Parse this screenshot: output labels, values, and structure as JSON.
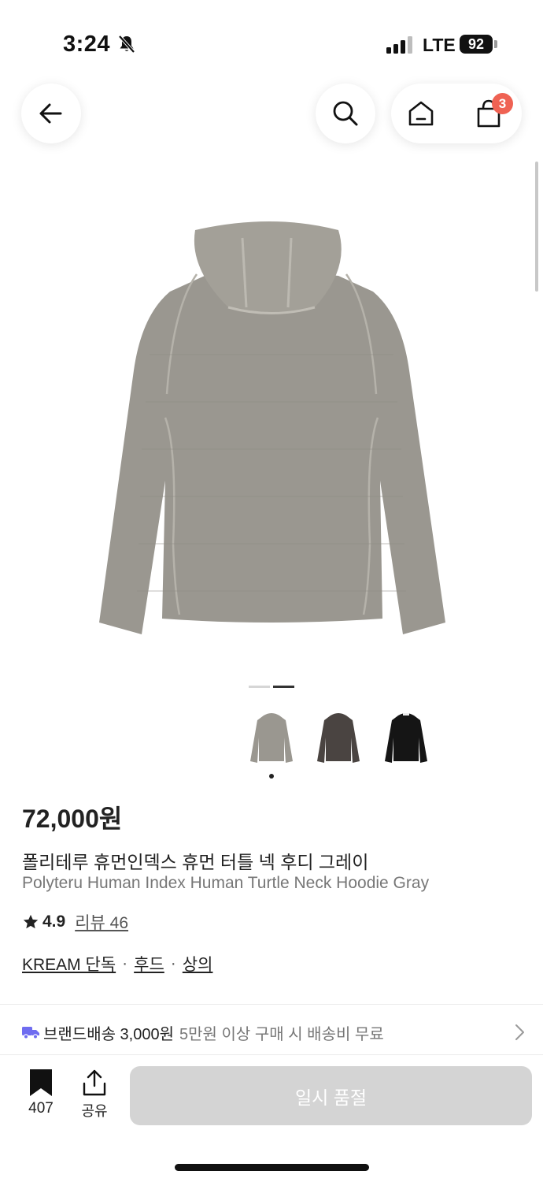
{
  "status_bar": {
    "time": "3:24",
    "network": "LTE",
    "battery": "92",
    "icons": [
      "bell-slash-icon",
      "signal-icon",
      "battery-icon"
    ]
  },
  "header": {
    "back_icon": "arrow-left-icon",
    "search_icon": "search-icon",
    "home_icon": "home-icon",
    "cart_icon": "shopping-bag-icon",
    "cart_badge": "3",
    "badge_color": "#ef6253"
  },
  "gallery": {
    "page_count": 2,
    "active_page": 2,
    "thumbnails": [
      {
        "color_name": "gray",
        "hex": "#9a9790"
      },
      {
        "color_name": "charcoal",
        "hex": "#4a4441"
      },
      {
        "color_name": "black",
        "hex": "#151515"
      }
    ],
    "selected_thumbnail": 1
  },
  "product": {
    "price": "72,000원",
    "title_ko": "폴리테루 휴먼인덱스 휴먼 터틀 넥 후디 그레이",
    "title_en": "Polyteru Human Index Human Turtle Neck Hoodie Gray",
    "rating": "4.9",
    "review_label": "리뷰 46",
    "categories": [
      "KREAM 단독",
      "후드",
      "상의"
    ],
    "category_separator": "·"
  },
  "shipping": {
    "main": "브랜드배송 3,000원",
    "sub": "5만원 이상 구매 시 배송비 무료",
    "accent": "#6f6cf0"
  },
  "bottom_bar": {
    "bookmark_count": "407",
    "share_label": "공유",
    "cta_label": "일시 품절",
    "cta_color": "#d4d4d4"
  }
}
